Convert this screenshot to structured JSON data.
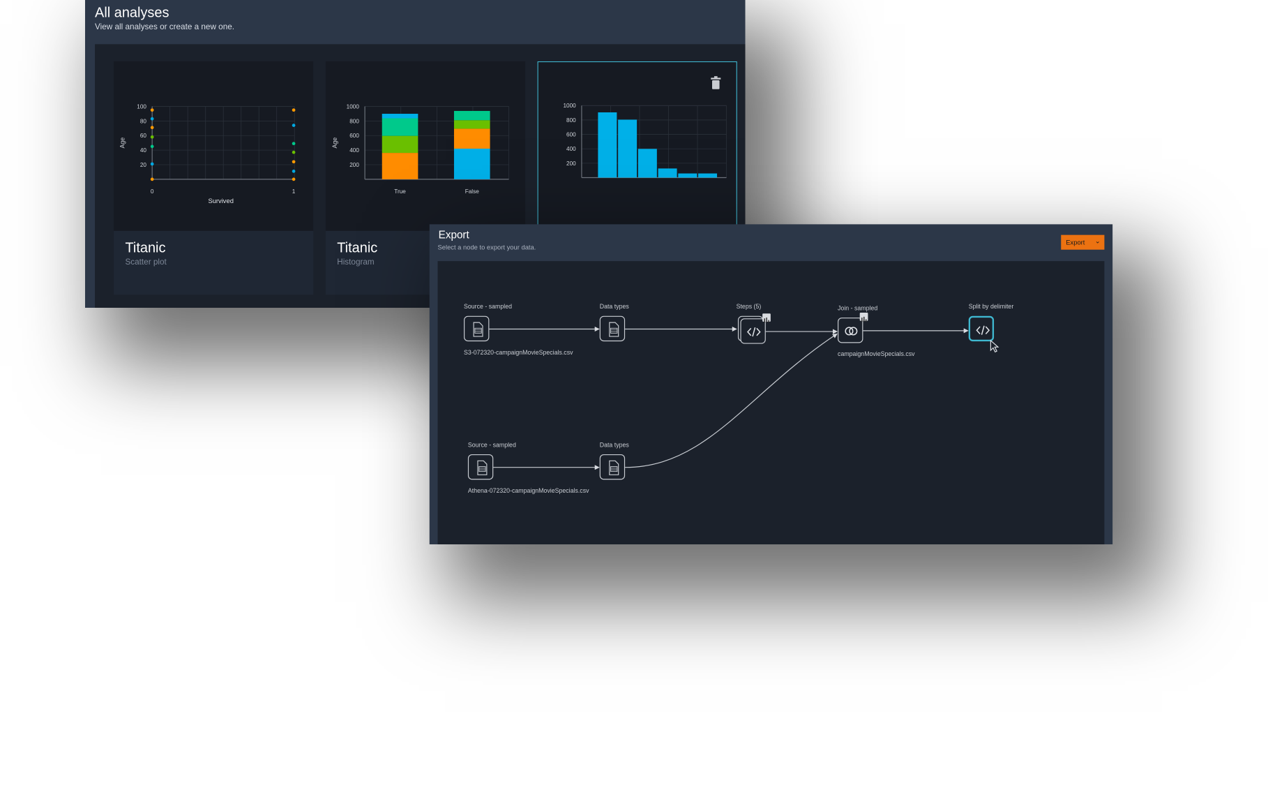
{
  "analyses": {
    "title": "All analyses",
    "subtitle": "View all analyses or create a new one.",
    "cards": [
      {
        "name": "Titanic",
        "type": "Scatter plot"
      },
      {
        "name": "Titanic",
        "type": "Histogram"
      },
      {
        "name": "",
        "type": "",
        "action_icon": "trash-icon"
      }
    ]
  },
  "export": {
    "title": "Export",
    "subtitle": "Select a node to export your data.",
    "button_label": "Export",
    "button_color": "#ec7211",
    "selected_color": "#3fb8d0",
    "nodes": [
      {
        "label": "Source - sampled",
        "file": "S3-072320-campaignMovieSpecials.csv",
        "icon": "file-table-icon"
      },
      {
        "label": "Data types",
        "file": "",
        "icon": "file-table-icon"
      },
      {
        "label": "Steps (5)",
        "file": "",
        "icon": "code-icon"
      },
      {
        "label": "Join - sampled",
        "file": "campaignMovieSpecials.csv",
        "icon": "join-icon"
      },
      {
        "label": "Split by delimiter",
        "file": "",
        "icon": "code-icon",
        "selected": true
      },
      {
        "label": "Source - sampled",
        "file": "Athena-072320-campaignMovieSpecials.csv",
        "icon": "file-table-icon"
      },
      {
        "label": "Data types",
        "file": "",
        "icon": "file-table-icon"
      }
    ]
  },
  "chart_data": [
    {
      "type": "scatter",
      "xlabel": "Survived",
      "ylabel": "Age",
      "xticks": [
        "0",
        "1"
      ],
      "yticks": [
        "20",
        "40",
        "60",
        "80",
        "100"
      ],
      "ylim": [
        0,
        100
      ],
      "grid": true,
      "points": [
        {
          "x": 0,
          "y": 95,
          "color": "#ff9900"
        },
        {
          "x": 0,
          "y": 83,
          "color": "#00a8e1"
        },
        {
          "x": 0,
          "y": 71,
          "color": "#ff9900"
        },
        {
          "x": 0,
          "y": 58,
          "color": "#6abf00"
        },
        {
          "x": 0,
          "y": 45,
          "color": "#00c98b"
        },
        {
          "x": 0,
          "y": 21,
          "color": "#00a8e1"
        },
        {
          "x": 0,
          "y": 0,
          "color": "#ff9900"
        },
        {
          "x": 1,
          "y": 95,
          "color": "#ff9900"
        },
        {
          "x": 1,
          "y": 74,
          "color": "#00a8e1"
        },
        {
          "x": 1,
          "y": 49,
          "color": "#00c98b"
        },
        {
          "x": 1,
          "y": 37,
          "color": "#6abf00"
        },
        {
          "x": 1,
          "y": 24,
          "color": "#ff9900"
        },
        {
          "x": 1,
          "y": 11,
          "color": "#00a8e1"
        },
        {
          "x": 1,
          "y": 0,
          "color": "#ff9900"
        }
      ]
    },
    {
      "type": "bar",
      "stacked": true,
      "ylabel": "Age",
      "categories": [
        "True",
        "False"
      ],
      "yticks": [
        "200",
        "400",
        "600",
        "800",
        "1000"
      ],
      "ylim": [
        0,
        1000
      ],
      "grid": true,
      "stacks": [
        [
          {
            "value": 362,
            "color": "#ff8c00"
          },
          {
            "value": 234,
            "color": "#6abf00"
          },
          {
            "value": 241,
            "color": "#00c98b"
          },
          {
            "value": 62,
            "color": "#00b0e8"
          }
        ],
        [
          {
            "value": 420,
            "color": "#00b0e8"
          },
          {
            "value": 274,
            "color": "#ff8c00"
          },
          {
            "value": 117,
            "color": "#6abf00"
          },
          {
            "value": 127,
            "color": "#00c98b"
          }
        ]
      ]
    },
    {
      "type": "bar",
      "yticks": [
        "200",
        "400",
        "600",
        "800",
        "1000"
      ],
      "ylim": [
        0,
        1000
      ],
      "grid": true,
      "values": [
        906,
        805,
        399,
        127,
        58,
        58
      ],
      "color": "#00b0e8"
    }
  ]
}
